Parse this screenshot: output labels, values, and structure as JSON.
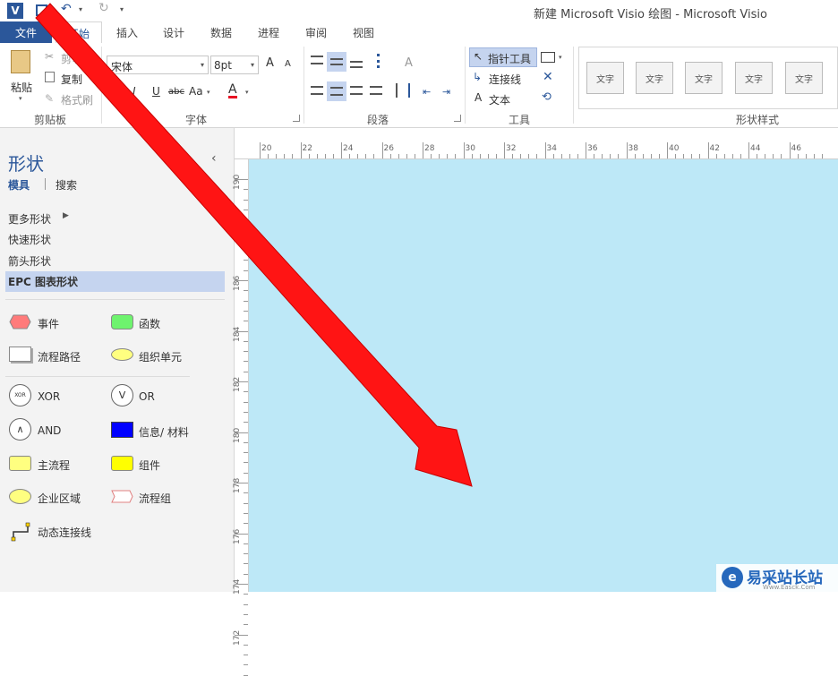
{
  "titlebar": {
    "title": "新建 Microsoft Visio 绘图 - Microsoft Visio",
    "app_icon_letter": "V"
  },
  "tabs": [
    "文件",
    "开始",
    "插入",
    "设计",
    "数据",
    "进程",
    "审阅",
    "视图"
  ],
  "ribbon": {
    "clipboard": {
      "paste": "粘贴",
      "cut": "剪切",
      "copy": "复制",
      "format_painter": "格式刷",
      "label": "剪贴板"
    },
    "font": {
      "name": "宋体",
      "size": "8pt",
      "label": "字体",
      "bold": "B",
      "italic": "I",
      "underline": "U",
      "strike": "abc",
      "case": "Aa",
      "color": "A",
      "grow": "A",
      "shrink": "A"
    },
    "paragraph": {
      "label": "段落"
    },
    "tools": {
      "pointer": "指针工具",
      "connector": "连接线",
      "text": "文本",
      "label": "工具"
    },
    "styles": {
      "swatch_label": "文字",
      "label": "形状样式"
    }
  },
  "shapes_panel": {
    "title": "形状",
    "tab_stencils": "模具",
    "tab_search": "搜索",
    "collapse": "‹",
    "more_shapes": "更多形状",
    "quick_shapes": "快速形状",
    "arrow_shapes": "箭头形状",
    "epc_shapes": "EPC 图表形状",
    "items": [
      "事件",
      "函数",
      "流程路径",
      "组织单元",
      "XOR",
      "OR",
      "AND",
      "信息/ 材料",
      "主流程",
      "组件",
      "企业区域",
      "流程组",
      "动态连接线"
    ],
    "xor_glyph": "XOR",
    "or_glyph": "V",
    "and_glyph": "∧"
  },
  "ruler": {
    "h_labels": [
      "20",
      "22",
      "24",
      "26",
      "28",
      "30",
      "32",
      "34",
      "36",
      "38",
      "40",
      "42",
      "44",
      "46"
    ],
    "v_labels": [
      "190",
      "188",
      "186",
      "184",
      "182",
      "180",
      "178",
      "176",
      "174",
      "172"
    ]
  },
  "watermark": {
    "text": "易采站长站",
    "url_text": "Www.Easck.Com"
  },
  "colors": {
    "accent": "#2b579a",
    "canvas": "#bde8f7",
    "arrow": "#ff1414",
    "epc_event": "#ff7b7b",
    "epc_function": "#6ef36e",
    "epc_yellow": "#ffff80",
    "epc_blue": "#0000ff"
  }
}
